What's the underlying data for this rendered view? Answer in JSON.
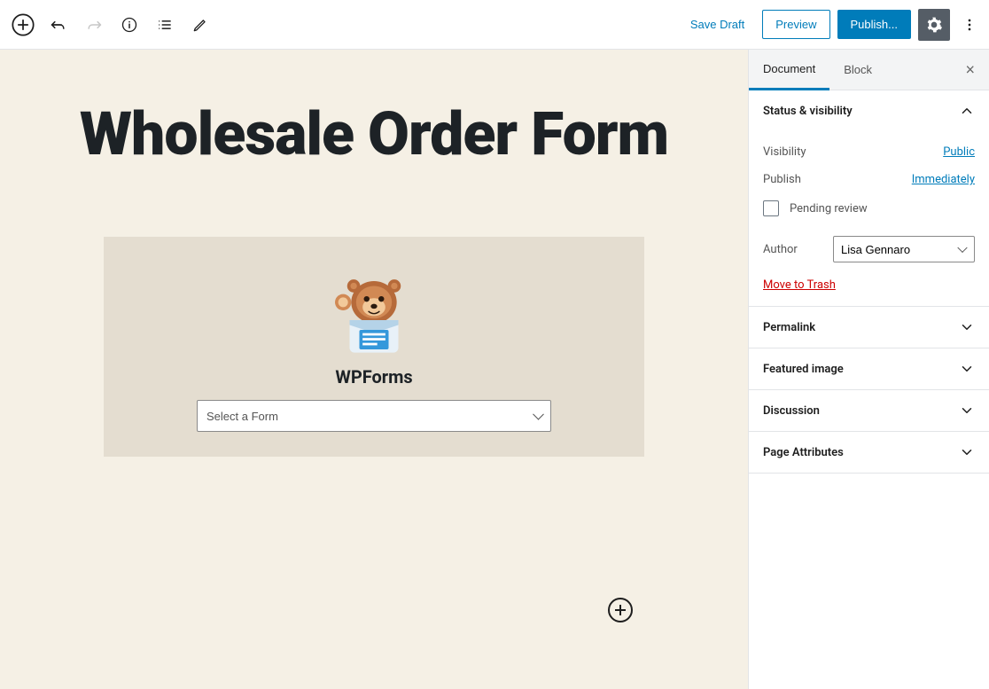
{
  "topbar": {
    "save_draft": "Save Draft",
    "preview": "Preview",
    "publish": "Publish..."
  },
  "editor": {
    "page_title": "Wholesale Order Form",
    "block_name": "WPForms",
    "select_placeholder": "Select a Form"
  },
  "sidebar": {
    "tabs": {
      "document": "Document",
      "block": "Block"
    },
    "status": {
      "header": "Status & visibility",
      "visibility_label": "Visibility",
      "visibility_value": "Public",
      "publish_label": "Publish",
      "publish_value": "Immediately",
      "pending_review": "Pending review",
      "author_label": "Author",
      "author_value": "Lisa Gennaro",
      "trash": "Move to Trash"
    },
    "sections": {
      "permalink": "Permalink",
      "featured_image": "Featured image",
      "discussion": "Discussion",
      "page_attributes": "Page Attributes"
    }
  }
}
